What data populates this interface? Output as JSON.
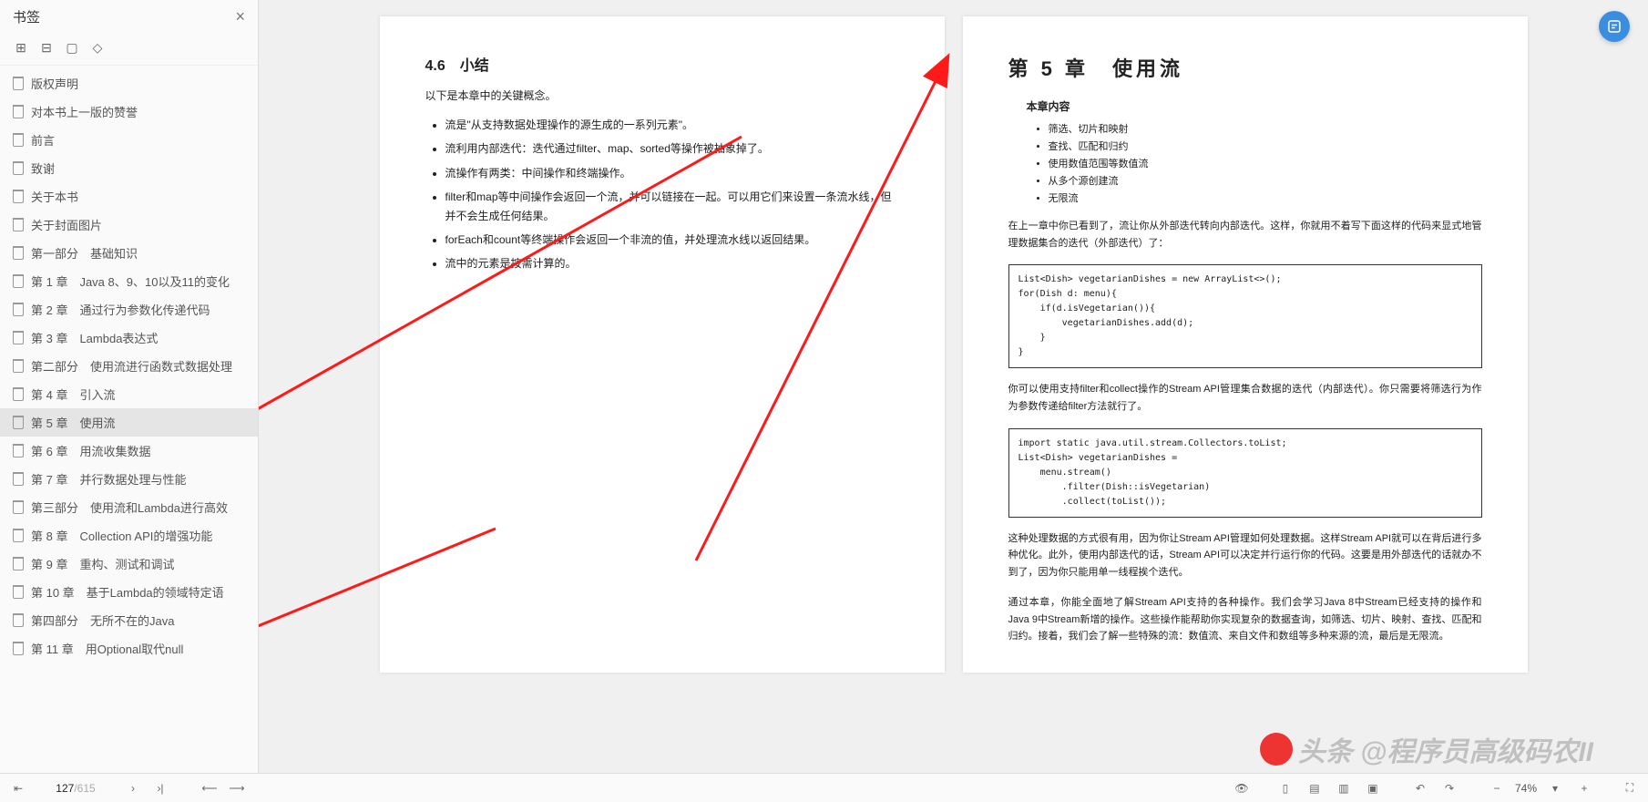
{
  "sidebar": {
    "title": "书签",
    "items": [
      {
        "label": "版权声明"
      },
      {
        "label": "对本书上一版的赞誉"
      },
      {
        "label": "前言"
      },
      {
        "label": "致谢"
      },
      {
        "label": "关于本书"
      },
      {
        "label": "关于封面图片"
      },
      {
        "label": "第一部分　基础知识"
      },
      {
        "label": "第 1 章　Java 8、9、10以及11的变化"
      },
      {
        "label": "第 2 章　通过行为参数化传递代码"
      },
      {
        "label": "第 3 章　Lambda表达式"
      },
      {
        "label": "第二部分　使用流进行函数式数据处理"
      },
      {
        "label": "第 4 章　引入流"
      },
      {
        "label": "第 5 章　使用流",
        "selected": true
      },
      {
        "label": "第 6 章　用流收集数据"
      },
      {
        "label": "第 7 章　并行数据处理与性能"
      },
      {
        "label": "第三部分　使用流和Lambda进行高效"
      },
      {
        "label": "第 8 章　Collection API的增强功能"
      },
      {
        "label": "第 9 章　重构、测试和调试"
      },
      {
        "label": "第 10 章　基于Lambda的领域特定语"
      },
      {
        "label": "第四部分　无所不在的Java"
      },
      {
        "label": "第 11 章　用Optional取代null"
      }
    ]
  },
  "leftPage": {
    "section": "4.6　小结",
    "intro": "以下是本章中的关键概念。",
    "bullets": [
      "流是\"从支持数据处理操作的源生成的一系列元素\"。",
      "流利用内部迭代：迭代通过filter、map、sorted等操作被抽象掉了。",
      "流操作有两类：中间操作和终端操作。",
      "filter和map等中间操作会返回一个流，并可以链接在一起。可以用它们来设置一条流水线，但并不会生成任何结果。",
      "forEach和count等终端操作会返回一个非流的值，并处理流水线以返回结果。",
      "流中的元素是按需计算的。"
    ]
  },
  "rightPage": {
    "chapter": "第 5 章　使用流",
    "contentsH": "本章内容",
    "contents": [
      "筛选、切片和映射",
      "查找、匹配和归约",
      "使用数值范围等数值流",
      "从多个源创建流",
      "无限流"
    ],
    "para1": "在上一章中你已看到了，流让你从外部迭代转向内部迭代。这样，你就用不着写下面这样的代码来显式地管理数据集合的迭代（外部迭代）了：",
    "code1": "List<Dish> vegetarianDishes = new ArrayList<>();\nfor(Dish d: menu){\n    if(d.isVegetarian()){\n        vegetarianDishes.add(d);\n    }\n}",
    "para2": "你可以使用支持filter和collect操作的Stream API管理集合数据的迭代（内部迭代）。你只需要将筛选行为作为参数传递给filter方法就行了。",
    "code2": "import static java.util.stream.Collectors.toList;\nList<Dish> vegetarianDishes =\n    menu.stream()\n        .filter(Dish::isVegetarian)\n        .collect(toList());",
    "para3": "这种处理数据的方式很有用，因为你让Stream API管理如何处理数据。这样Stream API就可以在背后进行多种优化。此外，使用内部迭代的话，Stream API可以决定并行运行你的代码。这要是用外部迭代的话就办不到了，因为你只能用单一线程挨个迭代。",
    "para4": "通过本章，你能全面地了解Stream API支持的各种操作。我们会学习Java 8中Stream已经支持的操作和Java 9中Stream新增的操作。这些操作能帮助你实现复杂的数据查询，如筛选、切片、映射、查找、匹配和归约。接着，我们会了解一些特殊的流：数值流、来自文件和数组等多种来源的流，最后是无限流。"
  },
  "bottom": {
    "pageCurrent": "127",
    "pageTotal": "/615",
    "zoom": "74%"
  },
  "watermark": "头条 @程序员高级码农II"
}
